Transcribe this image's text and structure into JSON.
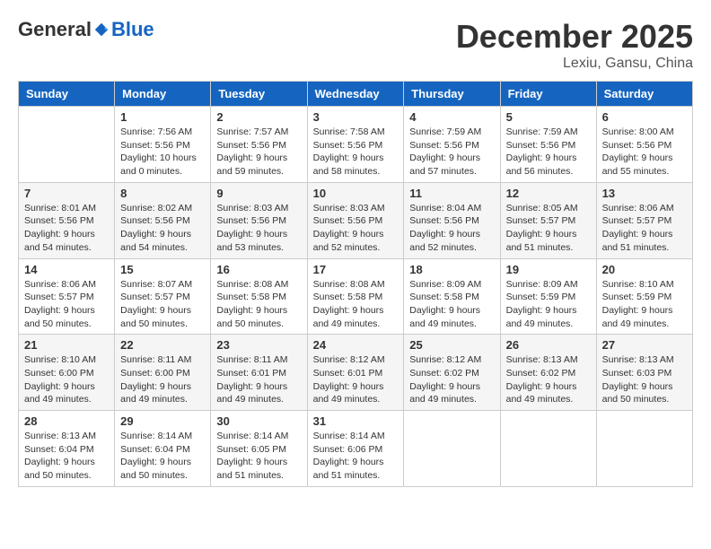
{
  "header": {
    "logo": {
      "general": "General",
      "blue": "Blue"
    },
    "title": "December 2025",
    "location": "Lexiu, Gansu, China"
  },
  "columns": [
    "Sunday",
    "Monday",
    "Tuesday",
    "Wednesday",
    "Thursday",
    "Friday",
    "Saturday"
  ],
  "weeks": [
    [
      {
        "day": "",
        "info": ""
      },
      {
        "day": "1",
        "info": "Sunrise: 7:56 AM\nSunset: 5:56 PM\nDaylight: 10 hours\nand 0 minutes."
      },
      {
        "day": "2",
        "info": "Sunrise: 7:57 AM\nSunset: 5:56 PM\nDaylight: 9 hours\nand 59 minutes."
      },
      {
        "day": "3",
        "info": "Sunrise: 7:58 AM\nSunset: 5:56 PM\nDaylight: 9 hours\nand 58 minutes."
      },
      {
        "day": "4",
        "info": "Sunrise: 7:59 AM\nSunset: 5:56 PM\nDaylight: 9 hours\nand 57 minutes."
      },
      {
        "day": "5",
        "info": "Sunrise: 7:59 AM\nSunset: 5:56 PM\nDaylight: 9 hours\nand 56 minutes."
      },
      {
        "day": "6",
        "info": "Sunrise: 8:00 AM\nSunset: 5:56 PM\nDaylight: 9 hours\nand 55 minutes."
      }
    ],
    [
      {
        "day": "7",
        "info": "Sunrise: 8:01 AM\nSunset: 5:56 PM\nDaylight: 9 hours\nand 54 minutes."
      },
      {
        "day": "8",
        "info": "Sunrise: 8:02 AM\nSunset: 5:56 PM\nDaylight: 9 hours\nand 54 minutes."
      },
      {
        "day": "9",
        "info": "Sunrise: 8:03 AM\nSunset: 5:56 PM\nDaylight: 9 hours\nand 53 minutes."
      },
      {
        "day": "10",
        "info": "Sunrise: 8:03 AM\nSunset: 5:56 PM\nDaylight: 9 hours\nand 52 minutes."
      },
      {
        "day": "11",
        "info": "Sunrise: 8:04 AM\nSunset: 5:56 PM\nDaylight: 9 hours\nand 52 minutes."
      },
      {
        "day": "12",
        "info": "Sunrise: 8:05 AM\nSunset: 5:57 PM\nDaylight: 9 hours\nand 51 minutes."
      },
      {
        "day": "13",
        "info": "Sunrise: 8:06 AM\nSunset: 5:57 PM\nDaylight: 9 hours\nand 51 minutes."
      }
    ],
    [
      {
        "day": "14",
        "info": "Sunrise: 8:06 AM\nSunset: 5:57 PM\nDaylight: 9 hours\nand 50 minutes."
      },
      {
        "day": "15",
        "info": "Sunrise: 8:07 AM\nSunset: 5:57 PM\nDaylight: 9 hours\nand 50 minutes."
      },
      {
        "day": "16",
        "info": "Sunrise: 8:08 AM\nSunset: 5:58 PM\nDaylight: 9 hours\nand 50 minutes."
      },
      {
        "day": "17",
        "info": "Sunrise: 8:08 AM\nSunset: 5:58 PM\nDaylight: 9 hours\nand 49 minutes."
      },
      {
        "day": "18",
        "info": "Sunrise: 8:09 AM\nSunset: 5:58 PM\nDaylight: 9 hours\nand 49 minutes."
      },
      {
        "day": "19",
        "info": "Sunrise: 8:09 AM\nSunset: 5:59 PM\nDaylight: 9 hours\nand 49 minutes."
      },
      {
        "day": "20",
        "info": "Sunrise: 8:10 AM\nSunset: 5:59 PM\nDaylight: 9 hours\nand 49 minutes."
      }
    ],
    [
      {
        "day": "21",
        "info": "Sunrise: 8:10 AM\nSunset: 6:00 PM\nDaylight: 9 hours\nand 49 minutes."
      },
      {
        "day": "22",
        "info": "Sunrise: 8:11 AM\nSunset: 6:00 PM\nDaylight: 9 hours\nand 49 minutes."
      },
      {
        "day": "23",
        "info": "Sunrise: 8:11 AM\nSunset: 6:01 PM\nDaylight: 9 hours\nand 49 minutes."
      },
      {
        "day": "24",
        "info": "Sunrise: 8:12 AM\nSunset: 6:01 PM\nDaylight: 9 hours\nand 49 minutes."
      },
      {
        "day": "25",
        "info": "Sunrise: 8:12 AM\nSunset: 6:02 PM\nDaylight: 9 hours\nand 49 minutes."
      },
      {
        "day": "26",
        "info": "Sunrise: 8:13 AM\nSunset: 6:02 PM\nDaylight: 9 hours\nand 49 minutes."
      },
      {
        "day": "27",
        "info": "Sunrise: 8:13 AM\nSunset: 6:03 PM\nDaylight: 9 hours\nand 50 minutes."
      }
    ],
    [
      {
        "day": "28",
        "info": "Sunrise: 8:13 AM\nSunset: 6:04 PM\nDaylight: 9 hours\nand 50 minutes."
      },
      {
        "day": "29",
        "info": "Sunrise: 8:14 AM\nSunset: 6:04 PM\nDaylight: 9 hours\nand 50 minutes."
      },
      {
        "day": "30",
        "info": "Sunrise: 8:14 AM\nSunset: 6:05 PM\nDaylight: 9 hours\nand 51 minutes."
      },
      {
        "day": "31",
        "info": "Sunrise: 8:14 AM\nSunset: 6:06 PM\nDaylight: 9 hours\nand 51 minutes."
      },
      {
        "day": "",
        "info": ""
      },
      {
        "day": "",
        "info": ""
      },
      {
        "day": "",
        "info": ""
      }
    ]
  ]
}
